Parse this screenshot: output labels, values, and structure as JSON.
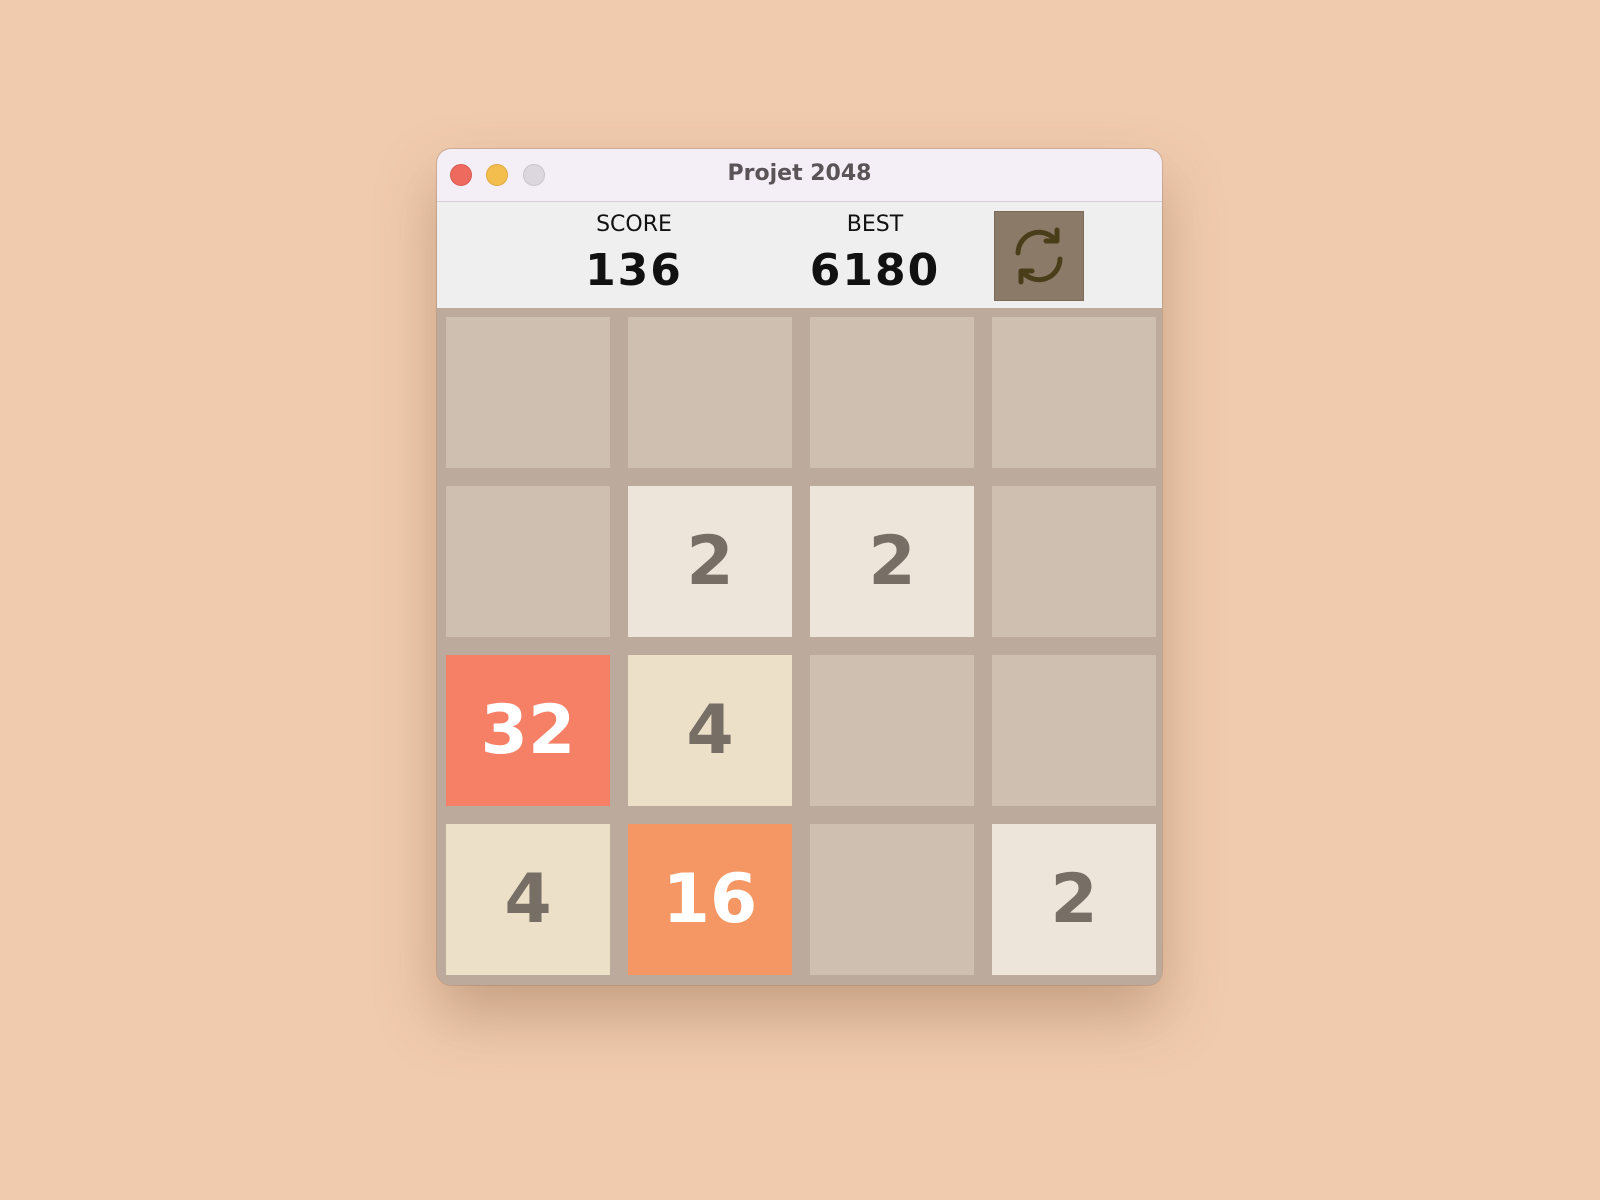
{
  "window": {
    "title": "Projet 2048"
  },
  "scores": {
    "score_label": "SCORE",
    "score_value": "136",
    "best_label": "BEST",
    "best_value": "6180"
  },
  "restart": {
    "icon": "refresh-icon"
  },
  "board": {
    "cells": [
      "",
      "",
      "",
      "",
      "",
      "2",
      "2",
      "",
      "32",
      "4",
      "",
      "",
      "4",
      "16",
      "",
      "2"
    ]
  },
  "colors": {
    "empty": "#cfbfb1",
    "2": "#ede4da",
    "4": "#ede0c8",
    "16": "#f59764",
    "32": "#f58066",
    "text_dark": "#776e65",
    "text_light": "#ffffff"
  }
}
